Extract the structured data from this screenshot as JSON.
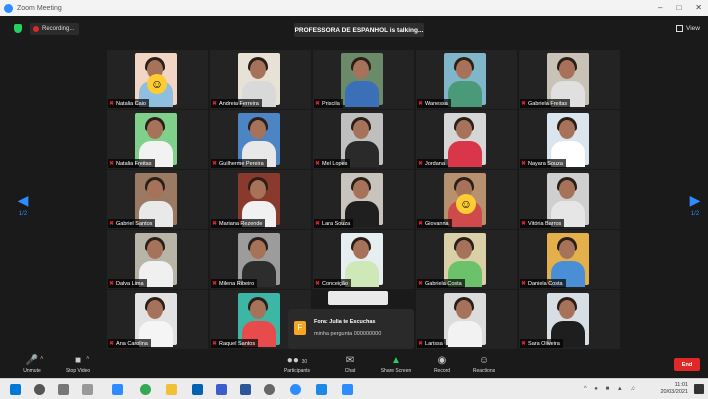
{
  "window": {
    "title": "Zoom Meeting"
  },
  "topbar": {
    "recording_label": "Recording...",
    "talking_label": "PROFESSORA DE ESPANHOL is talking...",
    "view_label": "View"
  },
  "pagination": {
    "left_page": "1/2",
    "right_page": "1/2"
  },
  "participants": [
    {
      "name": "Natalia Caio",
      "bg": "#f2d5c4",
      "shirt": "#8fbfe0",
      "emoji": true
    },
    {
      "name": "Andreia Ferreira",
      "bg": "#e8e2d6",
      "shirt": "#d9d9d9"
    },
    {
      "name": "Priscila",
      "bg": "#6b8a6a",
      "shirt": "#3b6fb8"
    },
    {
      "name": "Wanessa",
      "bg": "#7fb6c9",
      "shirt": "#4a9a7a"
    },
    {
      "name": "Gabriela Freitas",
      "bg": "#c9c2b6",
      "shirt": "#e0e0e0"
    },
    {
      "name": "Natalia Freitas",
      "bg": "#7ed08a",
      "shirt": "#f2f2f2"
    },
    {
      "name": "Guilherme Pereira",
      "bg": "#4d84c4",
      "shirt": "#e8e8e8"
    },
    {
      "name": "Mel Lopes",
      "bg": "#bfbfbf",
      "shirt": "#2a2a2a"
    },
    {
      "name": "Jordana",
      "bg": "#d6d6d6",
      "shirt": "#d9364a"
    },
    {
      "name": "Nayara Souza",
      "bg": "#dbe5ee",
      "shirt": "#ffffff"
    },
    {
      "name": "Gabriel Santos",
      "bg": "#9a7a63",
      "shirt": "#e9e9e9"
    },
    {
      "name": "Mariana Rezende",
      "bg": "#8a3a2c",
      "shirt": "#f1f1f1"
    },
    {
      "name": "Lara Souza",
      "bg": "#c8c3bd",
      "shirt": "#1f1f1f"
    },
    {
      "name": "Giovanna",
      "bg": "#b7916f",
      "shirt": "#cf4b4b",
      "emoji": true
    },
    {
      "name": "Vitória Barros",
      "bg": "#cfcfcf",
      "shirt": "#e6e6e6"
    },
    {
      "name": "Dalva Lima",
      "bg": "#b9b4a8",
      "shirt": "#f0f0f0"
    },
    {
      "name": "Milena Ribeiro",
      "bg": "#9c9c9c",
      "shirt": "#2d2d2d"
    },
    {
      "name": "Conceição",
      "bg": "#e6eef2",
      "shirt": "#cfe8b8"
    },
    {
      "name": "Gabriela Costa",
      "bg": "#d9d0a8",
      "shirt": "#6cc26a"
    },
    {
      "name": "Daniela Costa",
      "bg": "#e3b04b",
      "shirt": "#4a8fd6"
    },
    {
      "name": "Ana Carolina",
      "bg": "#e2e2e2",
      "shirt": "#f5f5f5"
    },
    {
      "name": "Raquel Santos",
      "bg": "#3db6a5",
      "shirt": "#e84b4b"
    },
    {
      "name": "",
      "bg": "#232323",
      "shirt": "#232323"
    },
    {
      "name": "Larissa",
      "bg": "#dcdcdc",
      "shirt": "#f2f2f2"
    },
    {
      "name": "Sara Oliveira",
      "bg": "#d8dfe4",
      "shirt": "#1e1e1e"
    }
  ],
  "toast": {
    "name": "Fora: Julia te Escuchas",
    "message": "minha pergunta 000000000"
  },
  "toolbar": {
    "unmute": "Unmute",
    "stop_video": "Stop Video",
    "participants": "Participants",
    "participants_count": "30",
    "chat": "Chat",
    "share_screen": "Share Screen",
    "record": "Record",
    "reactions": "Reactions",
    "end": "End"
  },
  "taskbar": {
    "time": "11:01",
    "date": "20/03/2021"
  },
  "colors": {
    "accent": "#2d8cff",
    "danger": "#e02828",
    "share_green": "#23d160"
  }
}
